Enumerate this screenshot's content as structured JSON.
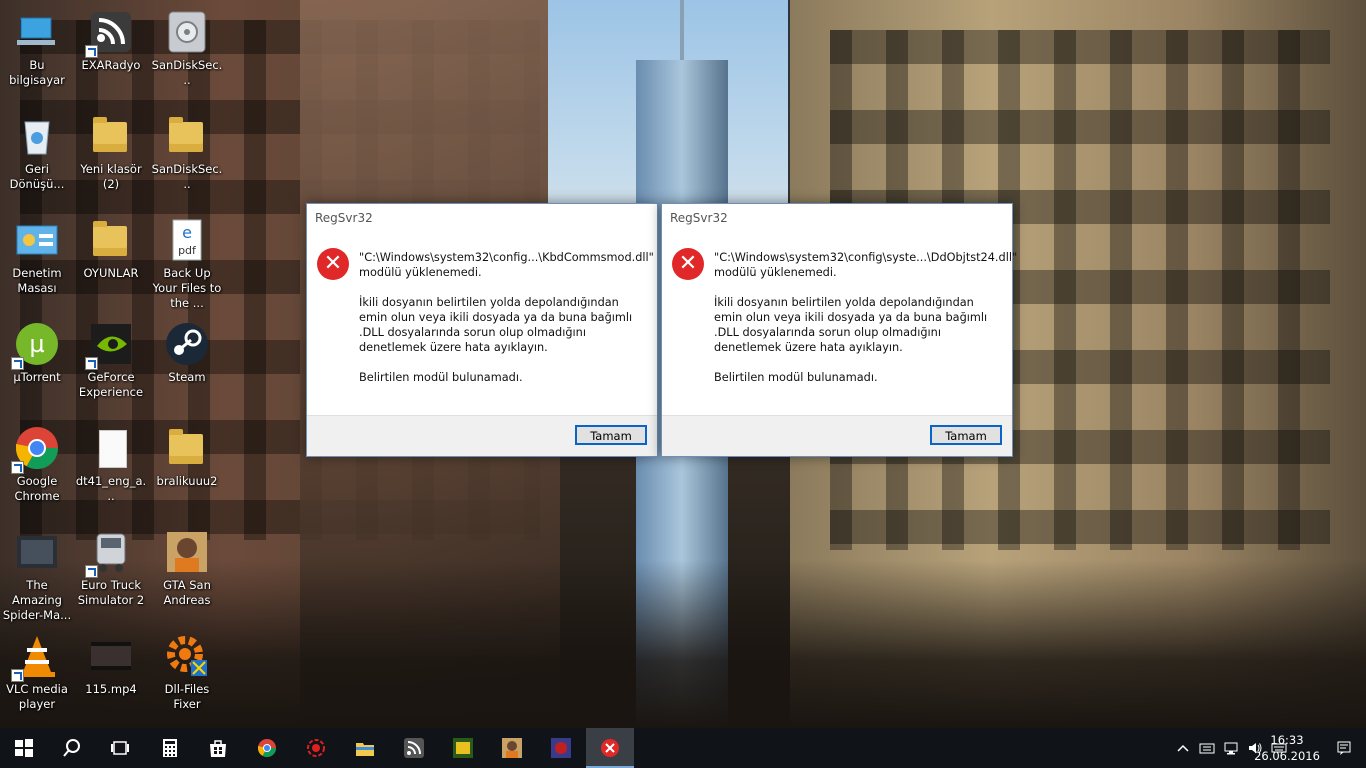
{
  "desktop": {
    "icons": [
      {
        "label": "Bu bilgisayar",
        "icon": "computer-icon"
      },
      {
        "label": "EXARadyo",
        "icon": "radio-icon"
      },
      {
        "label": "SanDiskSec...",
        "icon": "sandisk-safe-icon"
      },
      {
        "label": "Geri Dönüşü...",
        "icon": "recycle-bin-icon"
      },
      {
        "label": "Yeni klasör (2)",
        "icon": "folder-icon"
      },
      {
        "label": "SanDiskSec...",
        "icon": "folder-icon"
      },
      {
        "label": "Denetim Masası",
        "icon": "control-panel-icon"
      },
      {
        "label": "OYUNLAR",
        "icon": "folder-icon"
      },
      {
        "label": "Back Up Your Files to the ...",
        "icon": "pdf-icon"
      },
      {
        "label": "µTorrent",
        "icon": "utorrent-icon"
      },
      {
        "label": "GeForce Experience",
        "icon": "geforce-icon"
      },
      {
        "label": "Steam",
        "icon": "steam-icon"
      },
      {
        "label": "Google Chrome",
        "icon": "chrome-icon"
      },
      {
        "label": "dt41_eng_a...",
        "icon": "document-icon"
      },
      {
        "label": "bralikuuu2",
        "icon": "folder-icon"
      },
      {
        "label": "The Amazing Spider-Ma...",
        "icon": "spiderman-icon"
      },
      {
        "label": "Euro Truck Simulator 2",
        "icon": "truck-icon"
      },
      {
        "label": "GTA San Andreas",
        "icon": "gta-icon"
      },
      {
        "label": "VLC media player",
        "icon": "vlc-icon"
      },
      {
        "label": "115.mp4",
        "icon": "video-file-icon"
      },
      {
        "label": "Dll-Files Fixer",
        "icon": "dll-fixer-icon"
      }
    ]
  },
  "dialogs": [
    {
      "title": "RegSvr32",
      "path_line": "\"C:\\Windows\\system32\\config...\\KbdCommsmod.dll\"",
      "line1_suffix": "modülü yüklenemedi.",
      "paragraph2": "İkili dosyanın belirtilen yolda depolandığından emin olun veya ikili dosyada ya da buna bağımlı .DLL dosyalarında sorun olup olmadığını denetlemek üzere hata ayıklayın.",
      "paragraph3": "Belirtilen modül bulunamadı.",
      "ok_label": "Tamam"
    },
    {
      "title": "RegSvr32",
      "path_line": "\"C:\\Windows\\system32\\config\\syste...\\DdObjtst24.dll\"",
      "line1_suffix": "modülü yüklenemedi.",
      "paragraph2": "İkili dosyanın belirtilen yolda depolandığından emin olun veya ikili dosyada ya da buna bağımlı .DLL dosyalarında sorun olup olmadığını denetlemek üzere hata ayıklayın.",
      "paragraph3": "Belirtilen modül bulunamadı.",
      "ok_label": "Tamam"
    }
  ],
  "taskbar": {
    "items": [
      {
        "icon": "windows-start-icon"
      },
      {
        "icon": "search-icon"
      },
      {
        "icon": "task-view-icon"
      },
      {
        "icon": "calculator-icon"
      },
      {
        "icon": "store-icon"
      },
      {
        "icon": "chrome-icon"
      },
      {
        "icon": "media-center-icon"
      },
      {
        "icon": "file-explorer-icon"
      },
      {
        "icon": "exaradyo-icon"
      },
      {
        "icon": "game-icon"
      },
      {
        "icon": "gta-icon"
      },
      {
        "icon": "spiderman-icon"
      },
      {
        "icon": "regsvr32-error-icon",
        "active": true
      }
    ],
    "clock": {
      "time": "16:33",
      "date": "26.06.2016"
    },
    "colors": {
      "bar": "#101418",
      "active": "#3a3f45",
      "accent": "#7aa9d8"
    }
  },
  "colors": {
    "error": "#e12828",
    "button_border": "#0a64c8"
  }
}
